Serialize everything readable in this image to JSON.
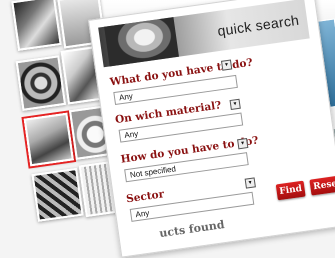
{
  "panel": {
    "title": "quick search"
  },
  "fields": [
    {
      "label": "What do you have to do?",
      "value": "Any"
    },
    {
      "label": "On wich material?",
      "value": "Any"
    },
    {
      "label": "How do you have to do?",
      "value": "Not specified"
    },
    {
      "label": "Sector",
      "value": "Any"
    }
  ],
  "buttons": {
    "find": "Find",
    "reset": "Reset"
  },
  "results": {
    "text": "ucts found"
  },
  "select_arrow_glyph": "▾",
  "colors": {
    "label": "#8a1111",
    "button": "#cc1d1d"
  }
}
